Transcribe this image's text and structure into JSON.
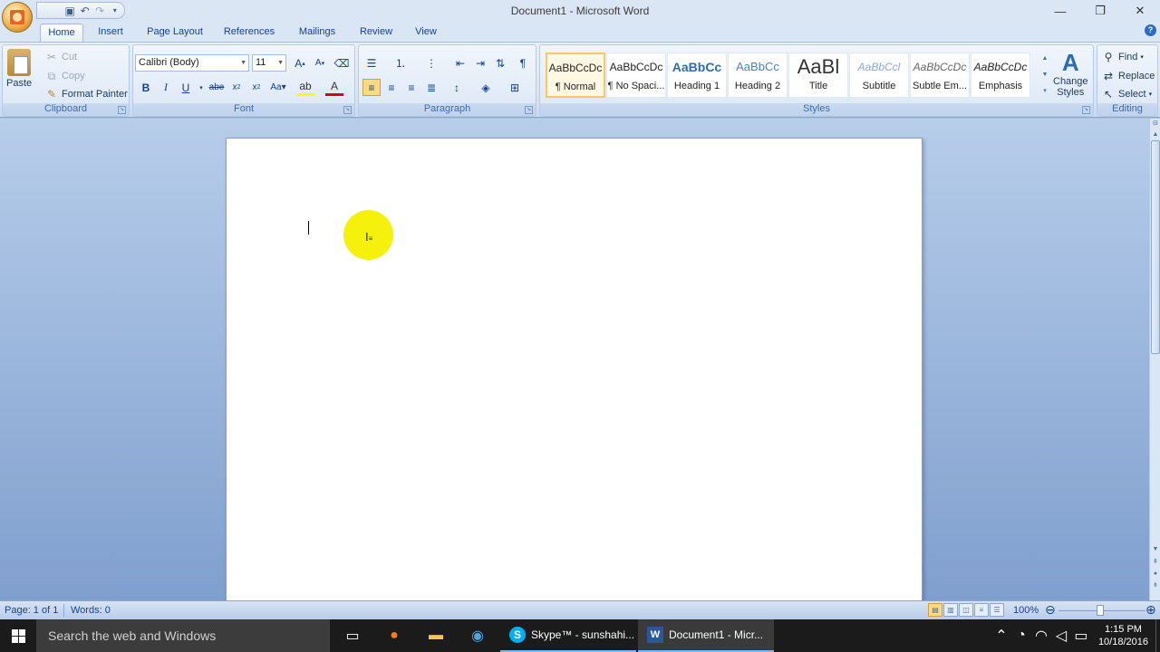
{
  "window": {
    "title": "Document1 - Microsoft Word",
    "controls": [
      "minimize-icon",
      "restore-icon",
      "close-icon"
    ]
  },
  "tabs": [
    {
      "label": "Home",
      "active": true
    },
    {
      "label": "Insert"
    },
    {
      "label": "Page Layout"
    },
    {
      "label": "References"
    },
    {
      "label": "Mailings"
    },
    {
      "label": "Review"
    },
    {
      "label": "View"
    }
  ],
  "clipboard": {
    "label": "Clipboard",
    "paste": "Paste",
    "cut": "Cut",
    "copy": "Copy",
    "format_painter": "Format Painter"
  },
  "font": {
    "label": "Font",
    "family": "Calibri (Body)",
    "size": "11"
  },
  "paragraph": {
    "label": "Paragraph"
  },
  "styles": {
    "label": "Styles",
    "items": [
      {
        "preview": "AaBbCcDc",
        "name": "¶ Normal",
        "selected": true
      },
      {
        "preview": "AaBbCcDc",
        "name": "¶ No Spaci..."
      },
      {
        "preview": "AaBbCc",
        "name": "Heading 1"
      },
      {
        "preview": "AaBbCc",
        "name": "Heading 2"
      },
      {
        "preview": "AaBl",
        "name": "Title"
      },
      {
        "preview": "AaBbCcl",
        "name": "Subtitle"
      },
      {
        "preview": "AaBbCcDc",
        "name": "Subtle Em..."
      },
      {
        "preview": "AaBbCcDc",
        "name": "Emphasis"
      }
    ],
    "change_styles_line1": "Change",
    "change_styles_line2": "Styles"
  },
  "editing": {
    "label": "Editing",
    "find": "Find",
    "replace": "Replace",
    "select": "Select"
  },
  "status": {
    "page": "Page: 1 of 1",
    "words": "Words: 0",
    "zoom": "100%"
  },
  "taskbar": {
    "search_placeholder": "Search the web and Windows",
    "apps": [
      {
        "label": "Skype™ - sunshahi..."
      },
      {
        "label": "Document1 - Micr...",
        "active": true
      }
    ],
    "time": "1:15 PM",
    "date": "10/18/2016"
  }
}
